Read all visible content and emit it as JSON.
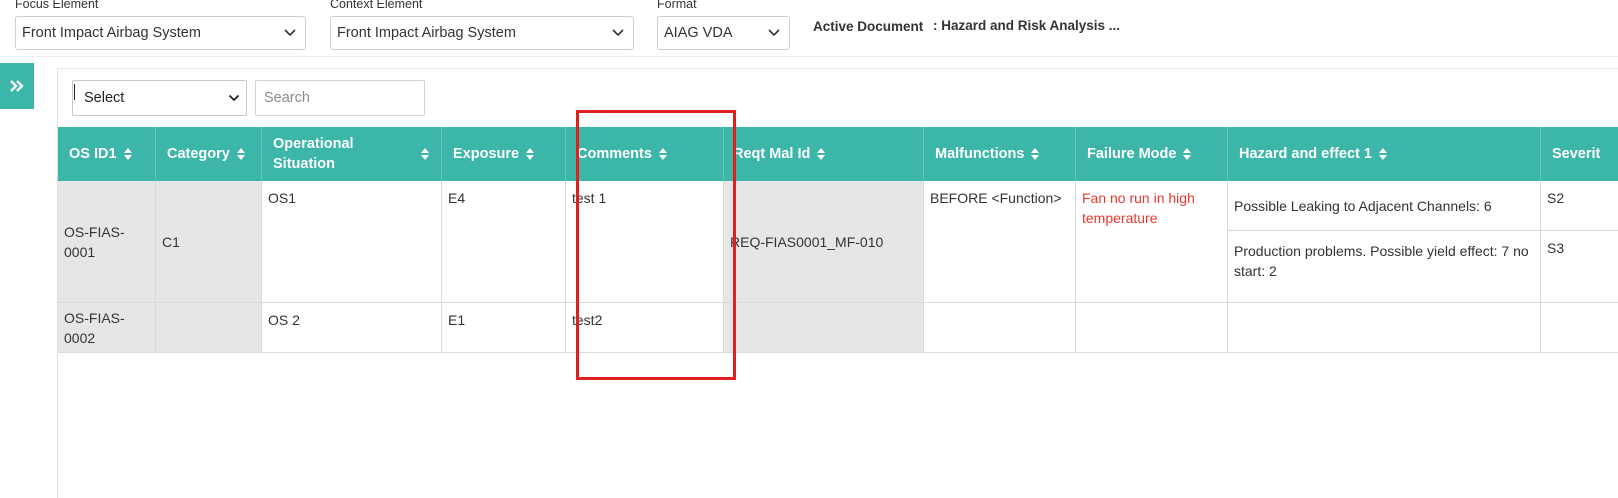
{
  "topbar": {
    "focus_label": "Focus Element",
    "focus_value": "Front Impact Airbag System",
    "context_label": "Context Element",
    "context_value": "Front Impact Airbag System",
    "format_label": "Format",
    "format_value": "AIAG VDA",
    "active_doc_label": "Active Document",
    "active_doc_value": ": Hazard and Risk Analysis ..."
  },
  "filter": {
    "select_value": "Select",
    "search_placeholder": "Search"
  },
  "table": {
    "headers": [
      "OS ID1",
      "Category",
      "Operational Situation",
      "Exposure",
      "Comments",
      "Reqt Mal Id",
      "Malfunctions",
      "Failure Mode",
      "Hazard and effect 1",
      "Severit"
    ],
    "rows": [
      {
        "os_id": "OS-FIAS-0001",
        "category": "C1",
        "operational_situation": "OS1",
        "exposure": "E4",
        "comments": "test 1",
        "reqt_mal_id": "REQ-FIAS0001_MF-010",
        "malfunctions": "BEFORE <Function>",
        "failure_mode": "Fan no run in high temperature",
        "hazards": [
          {
            "effect": "Possible Leaking to Adjacent Channels: 6",
            "severity": "S2"
          },
          {
            "effect": "Production problems. Possible yield effect: 7 no start: 2",
            "severity": "S3"
          }
        ]
      },
      {
        "os_id": "OS-FIAS-0002",
        "category": "",
        "operational_situation": "OS 2",
        "exposure": "E1",
        "comments": "test2",
        "reqt_mal_id": "",
        "malfunctions": "",
        "failure_mode": "",
        "hazards": [
          {
            "effect": "",
            "severity": ""
          }
        ]
      }
    ]
  },
  "colors": {
    "accent": "#3cb6a8",
    "grey_cell": "#e6e6e6",
    "highlight": "#e02020",
    "failure_text": "#e8382f"
  },
  "icons": {
    "expand": "chevron-double-right-icon",
    "dropdown": "chevron-down-icon",
    "sort": "sort-icon"
  }
}
